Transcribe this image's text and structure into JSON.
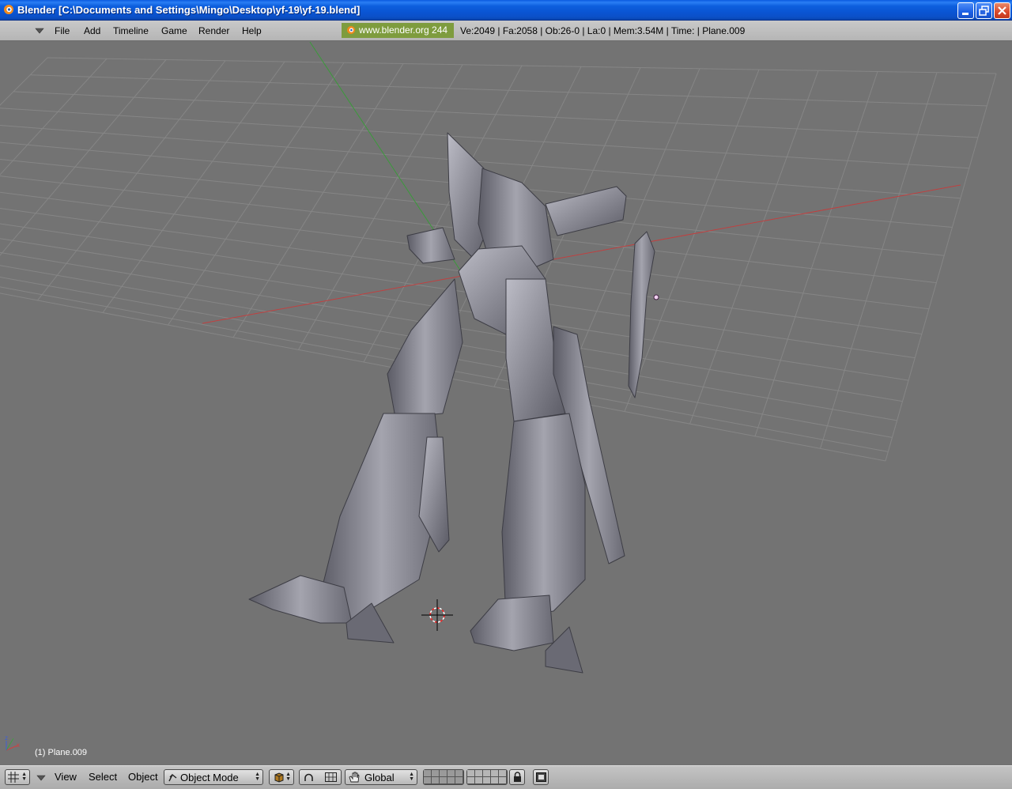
{
  "window": {
    "title": "Blender [C:\\Documents and Settings\\Mingo\\Desktop\\yf-19\\yf-19.blend]"
  },
  "menubar": {
    "items": [
      "File",
      "Add",
      "Timeline",
      "Game",
      "Render",
      "Help"
    ],
    "brand": "www.blender.org 244",
    "stats": "Ve:2049 | Fa:2058 | Ob:26-0 | La:0  | Mem:3.54M  | Time: | Plane.009"
  },
  "viewport": {
    "object_label": "(1) Plane.009",
    "axis_x": "x",
    "axis_z": "z"
  },
  "bottombar": {
    "view": "View",
    "select": "Select",
    "object": "Object",
    "mode": "Object Mode",
    "orientation": "Global"
  },
  "colors": {
    "titlebar": "#0a55d4",
    "viewport_bg": "#737373",
    "grid": "#868686",
    "x_axis": "#c04040",
    "y_axis": "#3a9a3a",
    "mesh": "#9a9aa4",
    "brand_bg": "#7e9c3e"
  }
}
